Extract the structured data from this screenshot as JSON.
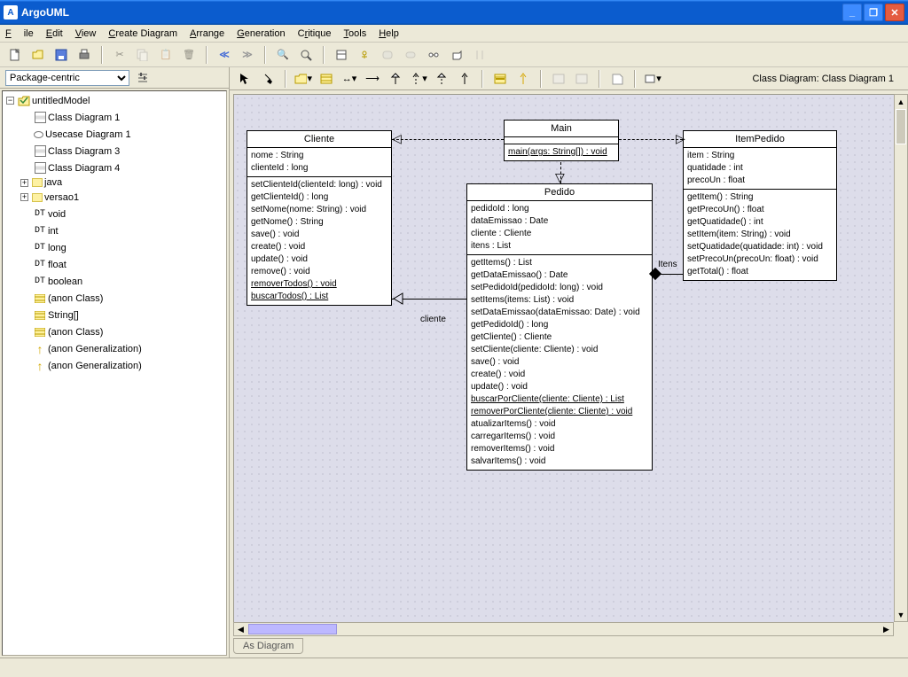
{
  "title": "ArgoUML",
  "menu": [
    "File",
    "Edit",
    "View",
    "Create Diagram",
    "Arrange",
    "Generation",
    "Critique",
    "Tools",
    "Help"
  ],
  "perspective": {
    "value": "Package-centric"
  },
  "tree": {
    "root": "untitledModel",
    "diagrams": [
      "Class Diagram 1",
      "Usecase Diagram 1",
      "Class Diagram 3",
      "Class Diagram 4"
    ],
    "packages": [
      "java",
      "versao1"
    ],
    "datatypes": [
      "void",
      "int",
      "long",
      "float",
      "boolean"
    ],
    "others": [
      "(anon Class)",
      "String[]",
      "(anon Class)",
      "(anon Generalization)",
      "(anon Generalization)"
    ]
  },
  "diagToolbarLabel": "Class Diagram: Class Diagram 1",
  "bottomTab": "As Diagram",
  "assoc": {
    "cliente": "cliente",
    "itens": "Itens"
  },
  "classes": {
    "main": {
      "name": "Main",
      "attrs": [],
      "ops": [
        "main(args: String[]) : void"
      ]
    },
    "cliente": {
      "name": "Cliente",
      "attrs": [
        "nome : String",
        "clienteId : long"
      ],
      "ops": [
        "setClienteId(clienteId: long) : void",
        "getClienteId() : long",
        "setNome(nome: String) : void",
        "getNome() : String",
        "save() : void",
        "create() : void",
        "update() : void",
        "remove() : void"
      ],
      "staticOps": [
        "removerTodos() : void",
        "buscarTodos() : List"
      ]
    },
    "pedido": {
      "name": "Pedido",
      "attrs": [
        "pedidoId : long",
        "dataEmissao : Date",
        "cliente : Cliente",
        "itens : List"
      ],
      "ops": [
        "getItems() : List",
        "getDataEmissao() : Date",
        "setPedidoId(pedidoId: long) : void",
        "setItems(items: List) : void",
        "setDataEmissao(dataEmissao: Date) : void",
        "getPedidoId() : long",
        "getCliente() : Cliente",
        "setCliente(cliente: Cliente) : void",
        "save() : void",
        "create() : void",
        "update() : void"
      ],
      "staticOps": [
        "buscarPorCliente(cliente: Cliente) : List",
        "removerPorCliente(cliente: Cliente) : void"
      ],
      "ops2": [
        "atualizarItems() : void",
        "carregarItems() : void",
        "removerItems() : void",
        "salvarItems() : void"
      ]
    },
    "itempedido": {
      "name": "ItemPedido",
      "attrs": [
        "item : String",
        "quatidade : int",
        "precoUn : float"
      ],
      "ops": [
        "getItem() : String",
        "getPrecoUn() : float",
        "getQuatidade() : int",
        "setItem(item: String) : void",
        "setQuatidade(quatidade: int) : void",
        "setPrecoUn(precoUn: float) : void",
        "getTotal() : float"
      ]
    }
  }
}
